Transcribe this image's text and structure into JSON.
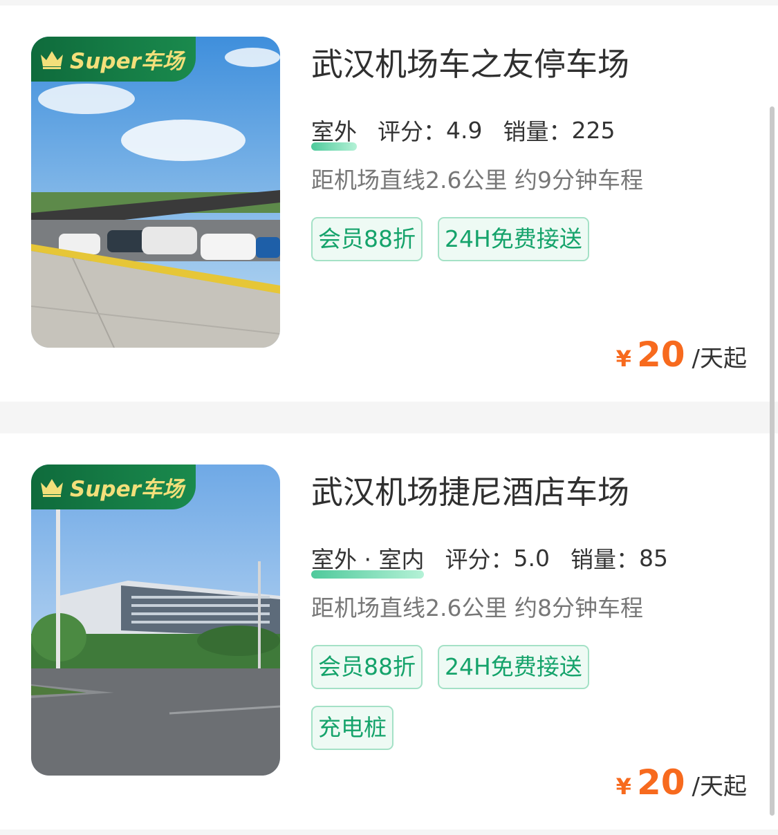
{
  "badge_label": "Super车场",
  "listings": [
    {
      "title": "武汉机场车之友停车场",
      "location_type": "室外",
      "rating_label": "评分：",
      "rating": "4.9",
      "sales_label": "销量：",
      "sales": "225",
      "distance": "距机场直线2.6公里 约9分钟车程",
      "tags": [
        "会员88折",
        "24H免费接送"
      ],
      "currency": "¥",
      "price": "20",
      "price_unit": "/天起"
    },
    {
      "title": "武汉机场捷尼酒店车场",
      "location_type": "室外 · 室内",
      "rating_label": "评分：",
      "rating": "5.0",
      "sales_label": "销量：",
      "sales": "85",
      "distance": "距机场直线2.6公里 约8分钟车程",
      "tags": [
        "会员88折",
        "24H免费接送",
        "充电桩"
      ],
      "currency": "¥",
      "price": "20",
      "price_unit": "/天起"
    }
  ],
  "colors": {
    "accent_green": "#15a36b",
    "price_orange": "#f76a1e",
    "badge_green": "#0f6b3c",
    "badge_gold": "#f3df7a"
  }
}
